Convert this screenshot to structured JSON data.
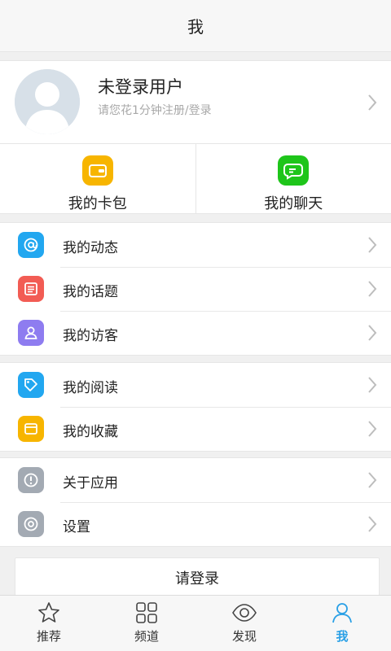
{
  "header": {
    "title": "我"
  },
  "profile": {
    "name": "未登录用户",
    "subtitle": "请您花1分钟注册/登录"
  },
  "quick": [
    {
      "label": "我的卡包",
      "icon": "wallet-icon",
      "color": "#f7b500"
    },
    {
      "label": "我的聊天",
      "icon": "chat-icon",
      "color": "#1ec51a"
    }
  ],
  "groups": [
    {
      "items": [
        {
          "label": "我的动态",
          "icon": "at-icon",
          "color": "#22a7f0"
        },
        {
          "label": "我的话题",
          "icon": "list-icon",
          "color": "#f25c54"
        },
        {
          "label": "我的访客",
          "icon": "person-icon",
          "color": "#8e7cf0"
        }
      ]
    },
    {
      "items": [
        {
          "label": "我的阅读",
          "icon": "tag-icon",
          "color": "#22a7f0"
        },
        {
          "label": "我的收藏",
          "icon": "folder-icon",
          "color": "#f7b500"
        }
      ]
    },
    {
      "items": [
        {
          "label": "关于应用",
          "icon": "info-icon",
          "color": "#a3aab3"
        },
        {
          "label": "设置",
          "icon": "settings-icon",
          "color": "#a3aab3"
        }
      ]
    }
  ],
  "login_button": "请登录",
  "tabs": [
    {
      "label": "推荐",
      "icon": "star-icon"
    },
    {
      "label": "频道",
      "icon": "grid-icon"
    },
    {
      "label": "发现",
      "icon": "eye-icon"
    },
    {
      "label": "我",
      "icon": "user-icon",
      "active": true
    }
  ],
  "accent_color": "#2aa0e6"
}
